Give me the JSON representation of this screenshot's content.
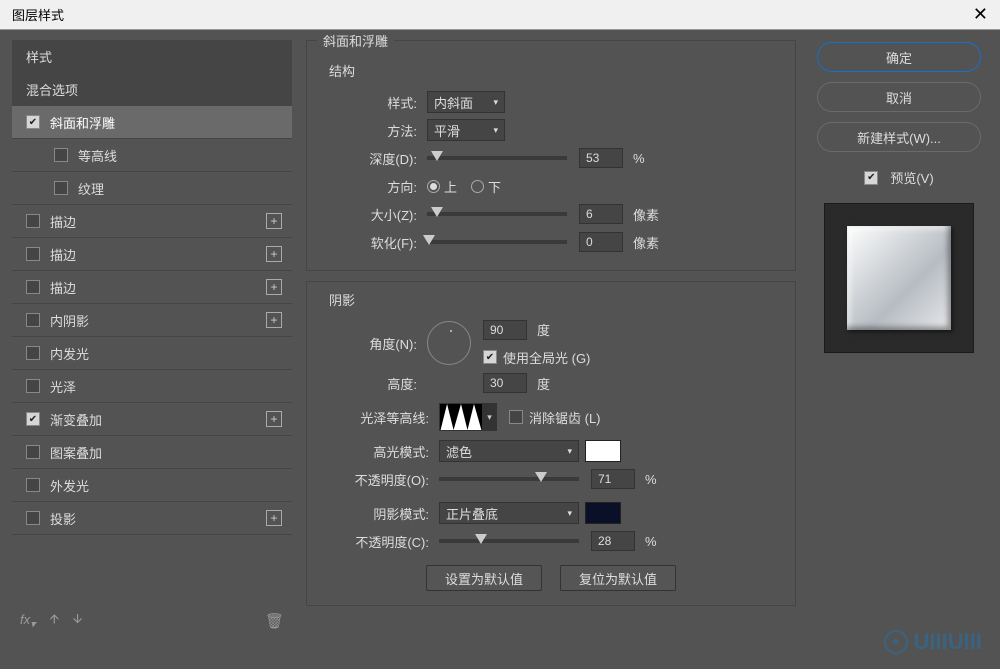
{
  "dialog_title": "图层样式",
  "left": {
    "header1": "样式",
    "header2": "混合选项",
    "items": [
      {
        "label": "斜面和浮雕",
        "checked": true,
        "selected": true,
        "indent": false,
        "plus": false
      },
      {
        "label": "等高线",
        "checked": false,
        "indent": true,
        "plus": false
      },
      {
        "label": "纹理",
        "checked": false,
        "indent": true,
        "plus": false
      },
      {
        "label": "描边",
        "checked": false,
        "indent": false,
        "plus": true
      },
      {
        "label": "描边",
        "checked": false,
        "indent": false,
        "plus": true
      },
      {
        "label": "描边",
        "checked": false,
        "indent": false,
        "plus": true
      },
      {
        "label": "内阴影",
        "checked": false,
        "indent": false,
        "plus": true
      },
      {
        "label": "内发光",
        "checked": false,
        "indent": false,
        "plus": false
      },
      {
        "label": "光泽",
        "checked": false,
        "indent": false,
        "plus": false
      },
      {
        "label": "渐变叠加",
        "checked": true,
        "indent": false,
        "plus": true
      },
      {
        "label": "图案叠加",
        "checked": false,
        "indent": false,
        "plus": false
      },
      {
        "label": "外发光",
        "checked": false,
        "indent": false,
        "plus": false
      },
      {
        "label": "投影",
        "checked": false,
        "indent": false,
        "plus": true
      }
    ],
    "fx_label": "fx"
  },
  "center": {
    "panel_title": "斜面和浮雕",
    "structure_title": "结构",
    "style_label": "样式:",
    "style_value": "内斜面",
    "technique_label": "方法:",
    "technique_value": "平滑",
    "depth_label": "深度(D):",
    "depth_value": "53",
    "depth_unit": "%",
    "direction_label": "方向:",
    "dir_up": "上",
    "dir_down": "下",
    "dir_selected": "up",
    "size_label": "大小(Z):",
    "size_value": "6",
    "size_unit": "像素",
    "soften_label": "软化(F):",
    "soften_value": "0",
    "soften_unit": "像素",
    "shading_title": "阴影",
    "angle_label": "角度(N):",
    "angle_value": "90",
    "angle_unit": "度",
    "global_light_label": "使用全局光 (G)",
    "global_light_checked": true,
    "altitude_label": "高度:",
    "altitude_value": "30",
    "altitude_unit": "度",
    "gloss_label": "光泽等高线:",
    "antialias_label": "消除锯齿 (L)",
    "antialias_checked": false,
    "highlight_mode_label": "高光模式:",
    "highlight_mode_value": "滤色",
    "highlight_opacity_label": "不透明度(O):",
    "highlight_opacity_value": "71",
    "highlight_opacity_unit": "%",
    "shadow_mode_label": "阴影模式:",
    "shadow_mode_value": "正片叠底",
    "shadow_opacity_label": "不透明度(C):",
    "shadow_opacity_value": "28",
    "shadow_opacity_unit": "%",
    "reset_default": "设置为默认值",
    "restore_default": "复位为默认值"
  },
  "right": {
    "ok": "确定",
    "cancel": "取消",
    "new_style": "新建样式(W)...",
    "preview_label": "预览(V)",
    "preview_checked": true
  },
  "watermark": "UIIIUIII"
}
